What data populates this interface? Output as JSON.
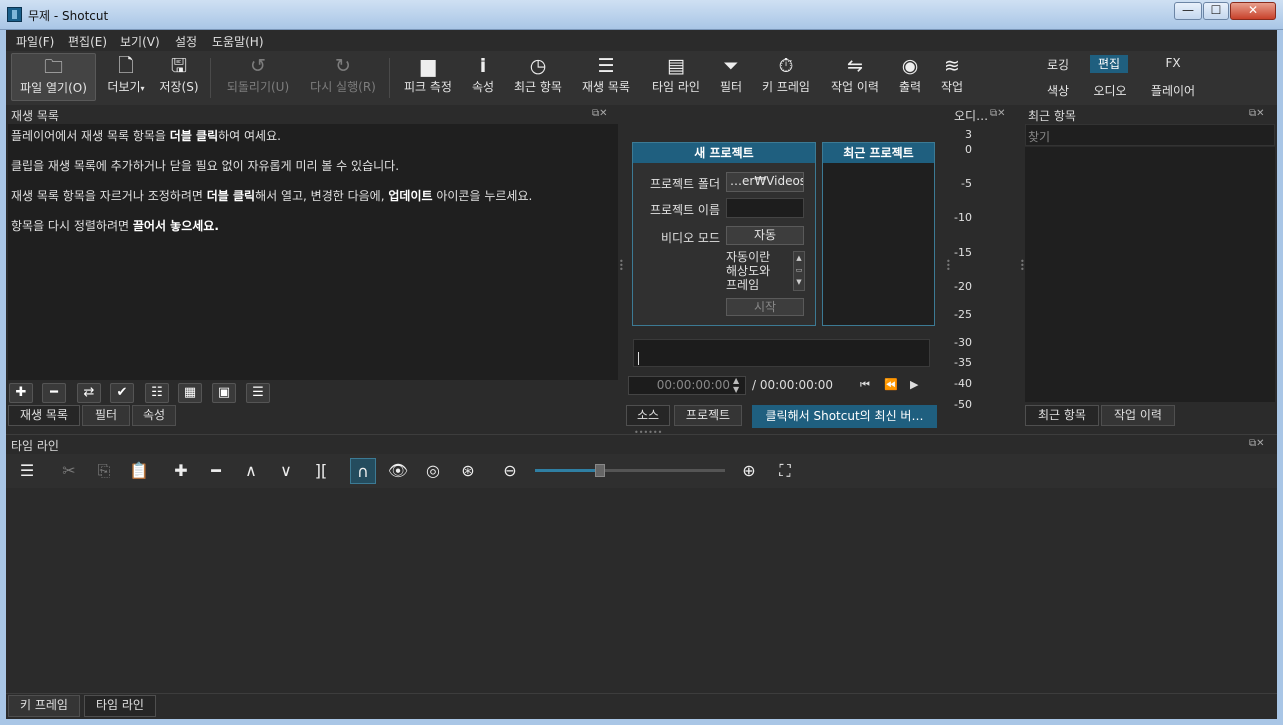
{
  "window": {
    "title": "무제 - Shotcut",
    "min": "—",
    "max": "☐",
    "close": "✕"
  },
  "menu": [
    "파일(F)",
    "편집(E)",
    "보기(V)",
    "설정",
    "도움말(H)"
  ],
  "toolbar": {
    "open": "파일 열기(O)",
    "more": "더보기",
    "save": "저장(S)",
    "undo": "되돌리기(U)",
    "redo": "다시 실행(R)",
    "peak": "피크 측정",
    "properties": "속성",
    "recent": "최근 항목",
    "playlist": "재생 목록",
    "timeline": "타임 라인",
    "filters": "필터",
    "keyframes": "키 프레임",
    "history": "작업 이력",
    "export": "출력",
    "jobs": "작업"
  },
  "layouts": {
    "logging": "로깅",
    "editing": "편집",
    "fx": "FX",
    "color": "색상",
    "audio": "오디오",
    "player": "플레이어"
  },
  "playlist": {
    "title": "재생 목록",
    "line1": {
      "a": "플레이어에서 재생 목록 항목을 ",
      "b": "더블 클릭",
      "c": "하여 여세요."
    },
    "line2": "클립을 재생 목록에 추가하거나 닫을 필요 없이 자유롭게 미리 볼 수 있습니다.",
    "line3": {
      "a": "재생 목록 항목을 자르거나 조정하려면 ",
      "b": "더블 클릭",
      "c": "해서 열고, 변경한 다음에, ",
      "d": "업데이트",
      "e": " 아이콘을 누르세요."
    },
    "line4": {
      "a": "항목을 다시 정렬하려면 ",
      "b": "끌어서 놓으세요."
    },
    "tabs": [
      "재생 목록",
      "필터",
      "속성"
    ]
  },
  "new_project": {
    "header": "새 프로젝트",
    "folder_label": "프로젝트 폴더",
    "folder_value": "…er₩Videos",
    "name_label": "프로젝트 이름",
    "mode_label": "비디오 모드",
    "mode_value": "자동",
    "mode_desc": [
      "자동이란",
      "해상도와",
      "프레임"
    ],
    "start": "시작"
  },
  "recent_projects": {
    "header": "최근 프로젝트"
  },
  "player": {
    "timecode": "00:00:00:00",
    "duration": "/ 00:00:00:00",
    "tabs": [
      "소스",
      "프로젝트"
    ],
    "update_notice": "클릭해서 Shotcut의 최신 버…"
  },
  "audio_meter": {
    "title": "오디…",
    "ticks": [
      "3",
      "0",
      "-5",
      "-10",
      "-15",
      "-20",
      "-25",
      "-30",
      "-35",
      "-40",
      "-50"
    ]
  },
  "recent": {
    "title": "최근 항목",
    "search_placeholder": "찾기",
    "tabs": [
      "최근 항목",
      "작업 이력"
    ]
  },
  "timeline": {
    "title": "타임 라인"
  },
  "bottom_tabs": [
    "키 프레임",
    "타임 라인"
  ],
  "colors": {
    "accent": "#1f5f7f",
    "panel": "#1f1f1f",
    "background": "#2b2b2b"
  }
}
